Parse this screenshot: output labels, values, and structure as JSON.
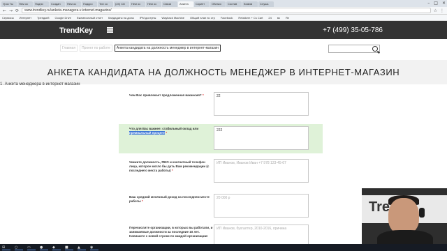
{
  "browser": {
    "tabs": [
      {
        "label": "Урок Ты",
        "active": false
      },
      {
        "label": "Нем ос",
        "active": false
      },
      {
        "label": "Подпи",
        "active": false
      },
      {
        "label": "Создан",
        "active": false
      },
      {
        "label": "Нем ос",
        "active": false
      },
      {
        "label": "Подкро",
        "active": false
      },
      {
        "label": "Тип со",
        "active": false
      },
      {
        "label": "(24) CD",
        "active": false
      },
      {
        "label": "Нем ос",
        "active": false
      },
      {
        "label": "Нем ос",
        "active": false
      },
      {
        "label": "Связи",
        "active": false
      },
      {
        "label": "Анкета",
        "active": true
      },
      {
        "label": "Скрипт",
        "active": false
      },
      {
        "label": "Облако",
        "active": false
      },
      {
        "label": "Состав",
        "active": false
      },
      {
        "label": "Комим",
        "active": false
      },
      {
        "label": "Слушь",
        "active": false
      }
    ],
    "url": "www.trendkey.ru/anketa-managera-v-internet-magazine/",
    "bookmarks": [
      "Сервисы",
      "Интернет",
      "Трендкей",
      "Google Drive",
      "Ежемесячный отчет",
      "Кандидаты на долж",
      "IPM доступы",
      "Wayback Machine",
      "Общий план по стр",
      "Facebook",
      "Retailcrm + Cs Cart",
      "24",
      "вк",
      "Ян"
    ]
  },
  "header": {
    "logo": "TrendKey",
    "phone": "+7 (499) 35-05-786"
  },
  "breadcrumbs": {
    "home": "Главная",
    "section": "Проект по работе",
    "current": "Анкета кандидата на должность менеджер в интернет-магазин"
  },
  "search": {
    "placeholder": ""
  },
  "page": {
    "title": "АНКЕТА КАНДИДАТА НА ДОЛЖНОСТЬ МЕНЕДЖЕР В ИНТЕРНЕТ-МАГАЗИН",
    "form_heading": "1. Анкета менеджера в интернет магазин"
  },
  "form": {
    "q1": {
      "label": "Чем Вас привлекает предложенная вакансия?",
      "required": "*",
      "value": "22"
    },
    "q2": {
      "label_before": "Что для Вас важнее: стабильный оклад или",
      "label_highlight": "премиальный процент",
      "required": "*",
      "value": "222"
    },
    "q3": {
      "label": "Укажите должность, ФИО и контактный телефон лица, которое могло бы дать Вам рекомендации (с последнего места работы)",
      "required": "*",
      "placeholder": "ИП Иванов, Иванов Иван +7 978 123-45-67"
    },
    "q4": {
      "label": "Ваш средний месячный доход на последнем месте работы",
      "required": "*",
      "placeholder": "20 000 р"
    },
    "q5": {
      "label": "Перечислите организации, в которых вы работали, и занимаемые должности за последние 10 лет. Напишите с новой строки по каждой организации:",
      "required": "",
      "placeholder": "ИП Иванов, бухгалтер, 2010-2016, причина"
    }
  },
  "webcam": {
    "logo": "Tren"
  },
  "taskbar": {
    "items": [
      "⊞",
      "○",
      "▭",
      "●",
      "◆",
      "■",
      "▲",
      "◉"
    ]
  },
  "colors": {
    "header_bg": "#343434",
    "highlight_row": "#dff2d8",
    "selection": "#3b74d6"
  }
}
